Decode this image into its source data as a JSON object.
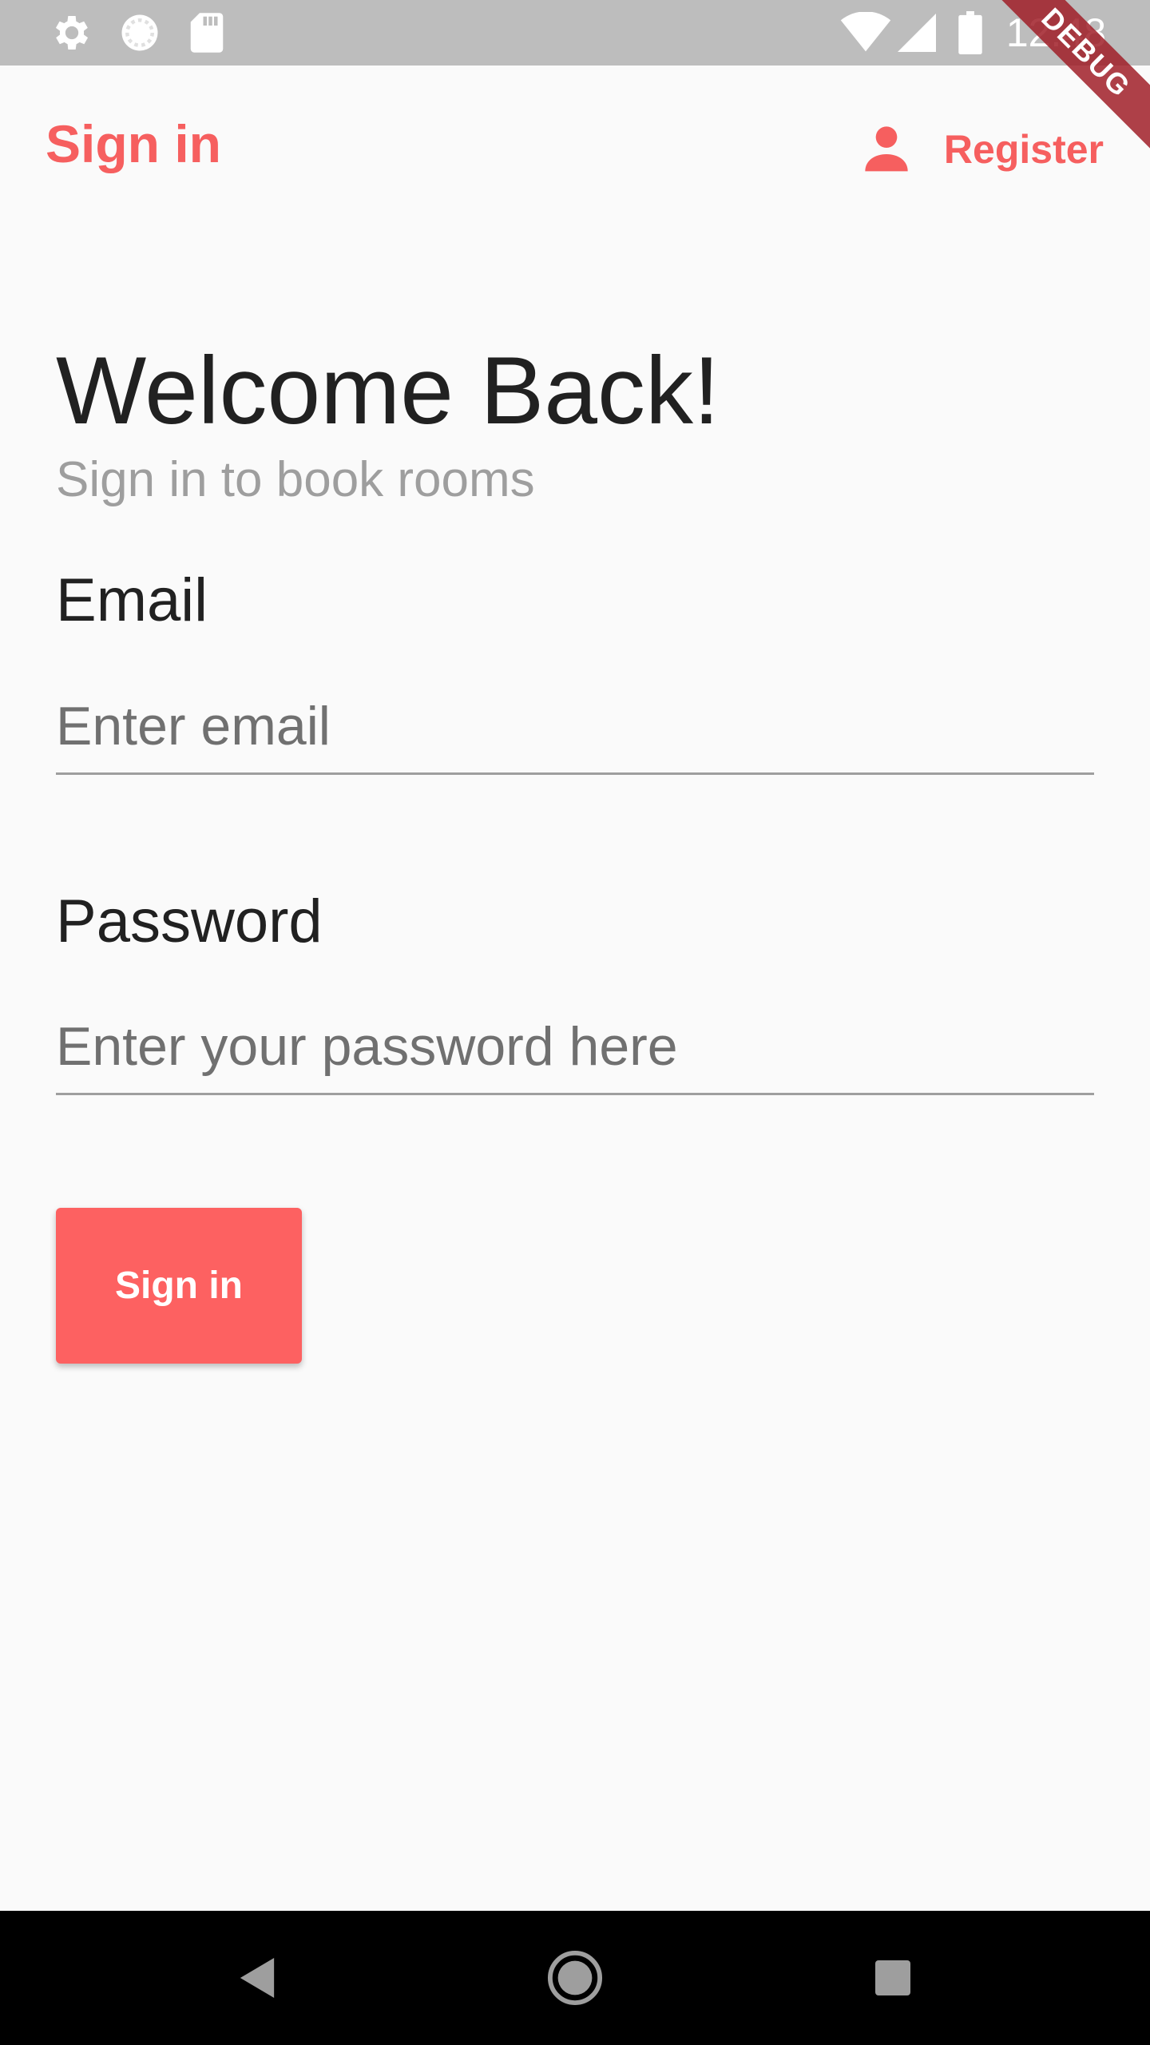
{
  "status_bar": {
    "time": "12:48",
    "icons": [
      "settings-icon",
      "sync-icon",
      "sd-card-icon",
      "wifi-icon",
      "signal-icon",
      "battery-icon"
    ]
  },
  "debug_banner": "DEBUG",
  "app_bar": {
    "title": "Sign in",
    "register_label": "Register",
    "register_icon": "person-icon"
  },
  "content": {
    "headline": "Welcome Back!",
    "subheadline": "Sign in to book rooms",
    "email": {
      "label": "Email",
      "placeholder": "Enter email",
      "value": ""
    },
    "password": {
      "label": "Password",
      "placeholder": "Enter your password here",
      "value": ""
    },
    "submit_label": "Sign in"
  },
  "nav_bar": {
    "buttons": [
      "back-icon",
      "home-icon",
      "recents-icon"
    ]
  },
  "colors": {
    "accent": "#f65f5f",
    "button": "#fd6161",
    "status_bar": "#bdbdbd",
    "nav_bar": "#000000"
  }
}
